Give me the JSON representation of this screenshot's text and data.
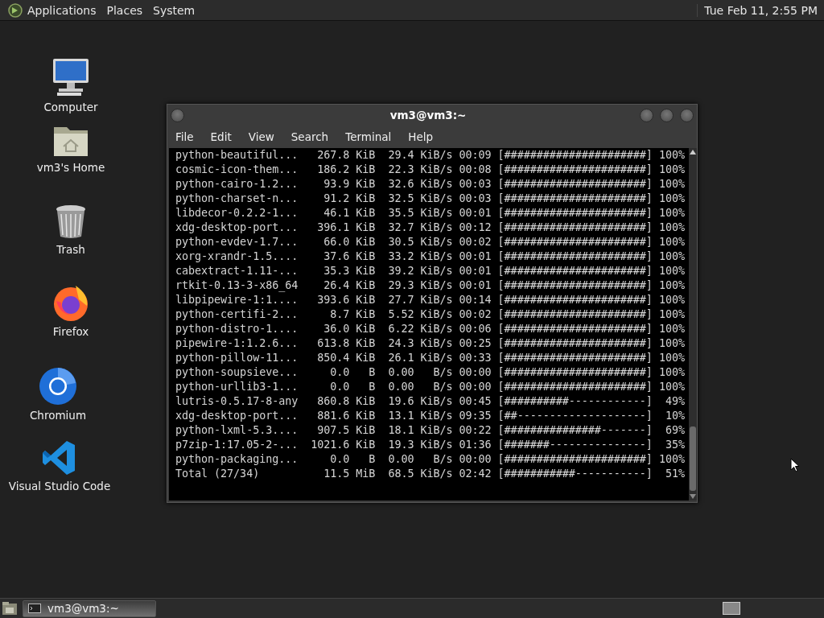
{
  "top_panel": {
    "menus": [
      "Applications",
      "Places",
      "System"
    ],
    "clock": "Tue Feb 11,  2:55 PM"
  },
  "desktop_icons": [
    {
      "kind": "computer",
      "label": "Computer"
    },
    {
      "kind": "home",
      "label": "vm3's Home"
    },
    {
      "kind": "trash",
      "label": "Trash"
    },
    {
      "kind": "firefox",
      "label": "Firefox"
    },
    {
      "kind": "chromium",
      "label": "Chromium"
    },
    {
      "kind": "vscode",
      "label": "Visual Studio Code"
    }
  ],
  "terminal": {
    "title": "vm3@vm3:~",
    "menu": [
      "File",
      "Edit",
      "View",
      "Search",
      "Terminal",
      "Help"
    ],
    "lines": [
      "python-beautiful...   267.8 KiB  29.4 KiB/s 00:09 [######################] 100%",
      "cosmic-icon-them...   186.2 KiB  22.3 KiB/s 00:08 [######################] 100%",
      "python-cairo-1.2...    93.9 KiB  32.6 KiB/s 00:03 [######################] 100%",
      "python-charset-n...    91.2 KiB  32.5 KiB/s 00:03 [######################] 100%",
      "libdecor-0.2.2-1...    46.1 KiB  35.5 KiB/s 00:01 [######################] 100%",
      "xdg-desktop-port...   396.1 KiB  32.7 KiB/s 00:12 [######################] 100%",
      "python-evdev-1.7...    66.0 KiB  30.5 KiB/s 00:02 [######################] 100%",
      "xorg-xrandr-1.5....    37.6 KiB  33.2 KiB/s 00:01 [######################] 100%",
      "cabextract-1.11-...    35.3 KiB  39.2 KiB/s 00:01 [######################] 100%",
      "rtkit-0.13-3-x86_64    26.4 KiB  29.3 KiB/s 00:01 [######################] 100%",
      "libpipewire-1:1....   393.6 KiB  27.7 KiB/s 00:14 [######################] 100%",
      "python-certifi-2...     8.7 KiB  5.52 KiB/s 00:02 [######################] 100%",
      "python-distro-1....    36.0 KiB  6.22 KiB/s 00:06 [######################] 100%",
      "pipewire-1:1.2.6...   613.8 KiB  24.3 KiB/s 00:25 [######################] 100%",
      "python-pillow-11...   850.4 KiB  26.1 KiB/s 00:33 [######################] 100%",
      "python-soupsieve...     0.0   B  0.00   B/s 00:00 [######################] 100%",
      "python-urllib3-1...     0.0   B  0.00   B/s 00:00 [######################] 100%",
      "lutris-0.5.17-8-any   860.8 KiB  19.6 KiB/s 00:45 [##########------------]  49%",
      "xdg-desktop-port...   881.6 KiB  13.1 KiB/s 09:35 [##--------------------]  10%",
      "python-lxml-5.3....   907.5 KiB  18.1 KiB/s 00:22 [###############-------]  69%",
      "p7zip-1:17.05-2-...  1021.6 KiB  19.3 KiB/s 01:36 [#######---------------]  35%",
      "python-packaging...     0.0   B  0.00   B/s 00:00 [######################] 100%",
      "Total (27/34)          11.5 MiB  68.5 KiB/s 02:42 [###########-----------]  51%"
    ]
  },
  "taskbar": {
    "tasks": [
      "vm3@vm3:~"
    ]
  }
}
